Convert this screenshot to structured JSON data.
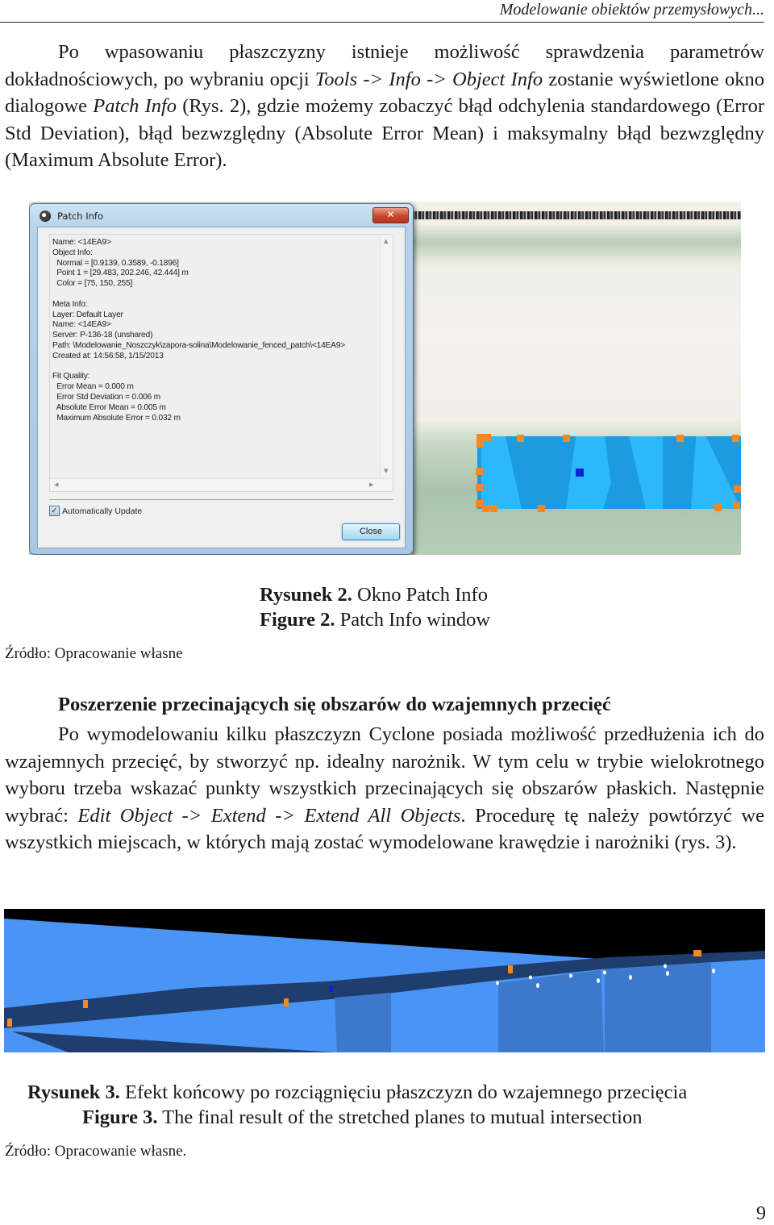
{
  "running_header": "Modelowanie obiektów przemysłowych...",
  "paragraph1": {
    "t1": "Po wpasowaniu płaszczyzny istnieje możliwość sprawdzenia parametrów dokładnościowych, po wybraniu opcji ",
    "i1": "Tools  -> Info -> Object Info",
    "t2": " zostanie wyświetlone okno dialogowe ",
    "i2": "Patch Info",
    "t3": " (Rys. 2), gdzie możemy zobaczyć błąd odchylenia standardowego (Error Std Deviation), błąd bezwzględny (Absolute Error Mean) i maksymalny błąd bezwzględny (Maximum Absolute Error)."
  },
  "figure2": {
    "dialog": {
      "title": "Patch Info",
      "close_x": "✕",
      "info_text": "Name: <14EA9>\nObject Info:\n  Normal = [0.9139, 0.3589, -0.1896]\n  Point 1 = [29.483, 202.246, 42.444] m\n  Color = [75, 150, 255]\n\nMeta Info:\nLayer: Default Layer\nName: <14EA9>\nServer: P-136-18 (unshared)\nPath: \\Modelowanie_Noszczyk\\zapora-solina\\Modelowanie_fenced_patch\\<14EA9>\nCreated at: 14:56:58, 1/15/2013\n\nFit Quality:\n  Error Mean = 0.000 m\n  Error Std Deviation = 0.006 m\n  Absolute Error Mean = 0.005 m\n  Maximum Absolute Error = 0.032 m",
      "checkbox_label": "Automatically Update",
      "checkbox_checked": true,
      "close_button": "Close"
    },
    "caption_pl_label": "Rysunek 2.",
    "caption_pl_text": " Okno Patch Info",
    "caption_en_label": "Figure 2.",
    "caption_en_text": " Patch Info window",
    "source": "Źródło: Opracowanie własne"
  },
  "heading": "Poszerzenie przecinających się obszarów do wzajemnych przecięć",
  "paragraph2": {
    "t1": "Po wymodelowaniu kilku płaszczyzn Cyclone posiada możliwość przedłużenia ich do wzajemnych przecięć, by stworzyć np. idealny narożnik. W tym celu w trybie wielokrotnego wyboru trzeba wskazać punkty wszystkich przecinających się obszarów płaskich. Następnie wybrać: ",
    "i1": "Edit Object -> Extend -> Extend All Objects",
    "t2": ". Procedurę tę należy powtórzyć we wszystkich miejscach, w których mają zostać wymodelowane krawędzie i narożniki (rys. 3)."
  },
  "figure3": {
    "caption_pl_label": "Rysunek 3.",
    "caption_pl_text": " Efekt końcowy po rozciągnięciu płaszczyzn do wzajemnego przecięcia",
    "caption_en_label": "Figure 3.",
    "caption_en_text": " The final result of the stretched planes to mutual intersection",
    "source": "Źródło: Opracowanie własne."
  },
  "page_number": "9"
}
